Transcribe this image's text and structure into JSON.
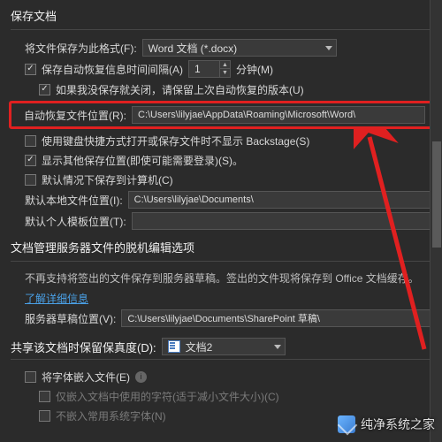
{
  "sections": {
    "save": {
      "title": "保存文档",
      "save_as_label": "将文件保存为此格式(F):",
      "save_as_value": "Word 文档 (*.docx)",
      "autosave_chk": "保存自动恢复信息时间间隔(A)",
      "autosave_minutes": "1",
      "minutes_unit": "分钟(M)",
      "keep_last_chk": "如果我没保存就关闭，请保留上次自动恢复的版本(U)",
      "autorecover_loc_label": "自动恢复文件位置(R):",
      "autorecover_loc_value": "C:\\Users\\lilyjae\\AppData\\Roaming\\Microsoft\\Word\\",
      "no_backstage_chk": "使用键盘快捷方式打开或保存文件时不显示 Backstage(S)",
      "show_other_chk": "显示其他保存位置(即使可能需要登录)(S)。",
      "save_to_pc_chk": "默认情况下保存到计算机(C)",
      "default_file_loc_label": "默认本地文件位置(I):",
      "default_file_loc_value": "C:\\Users\\lilyjae\\Documents\\",
      "personal_tmpl_label": "默认个人模板位置(T):",
      "personal_tmpl_value": ""
    },
    "offline": {
      "title": "文档管理服务器文件的脱机编辑选项",
      "desc": "不再支持将签出的文件保存到服务器草稿。签出的文件现将保存到 Office 文档缓存。",
      "link": "了解详细信息",
      "draft_label": "服务器草稿位置(V):",
      "draft_value": "C:\\Users\\lilyjae\\Documents\\SharePoint 草稿\\"
    },
    "fidelity": {
      "title_label": "共享该文档时保留保真度(D):",
      "doc_value": "文档2",
      "embed_fonts_chk": "将字体嵌入文件(E)",
      "embed_used_chk": "仅嵌入文档中使用的字符(适于减小文件大小)(C)",
      "no_common_chk": "不嵌入常用系统字体(N)"
    }
  },
  "watermark": "纯净系统之家"
}
